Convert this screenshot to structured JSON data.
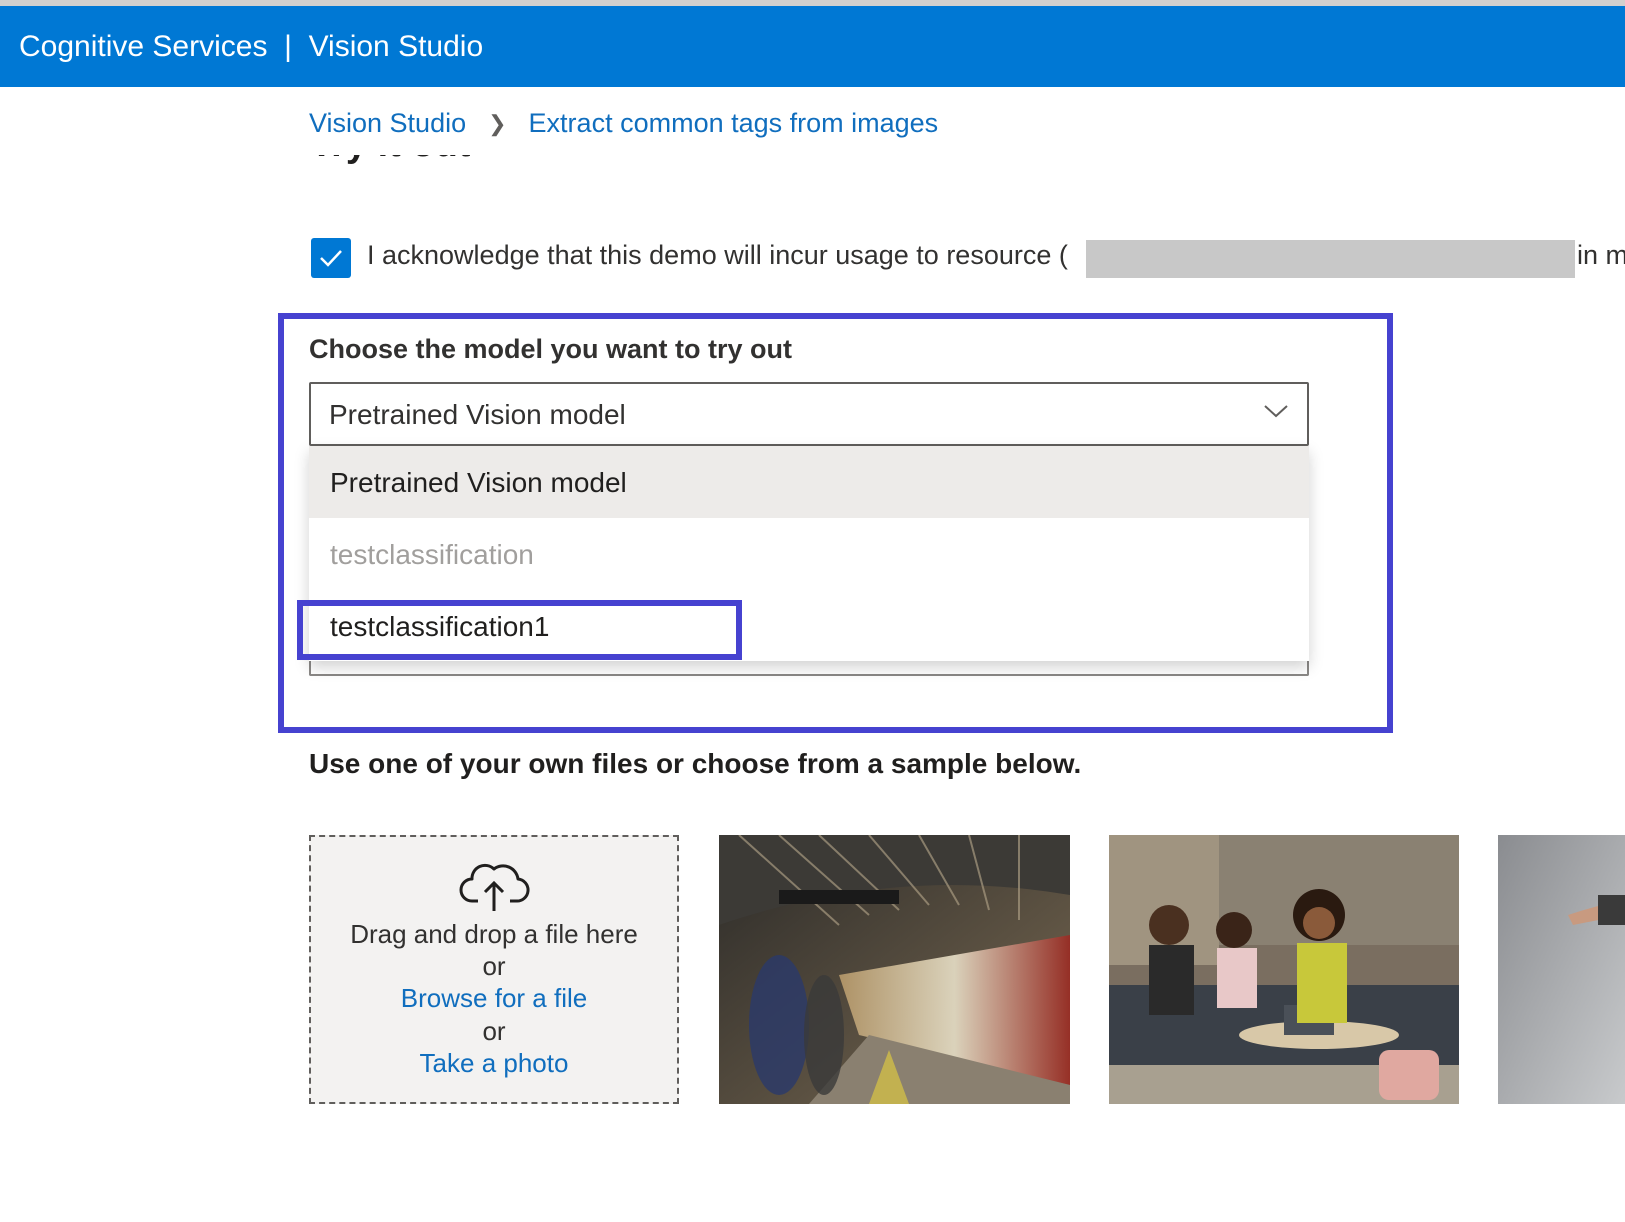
{
  "header": {
    "title": "Cognitive Services  |  Vision Studio"
  },
  "breadcrumb": {
    "home": "Vision Studio",
    "current": "Extract common tags from images"
  },
  "section": {
    "heading": "Try it out"
  },
  "acknowledge": {
    "checked": true,
    "text": "I acknowledge that this demo will incur usage to resource (",
    "tail": "in m"
  },
  "model": {
    "label": "Choose the model you want to try out",
    "selected": "Pretrained Vision model",
    "options": [
      {
        "label": "Pretrained Vision model",
        "state": "selected"
      },
      {
        "label": "testclassification",
        "state": "disabled"
      },
      {
        "label": "testclassification1",
        "state": "normal"
      }
    ]
  },
  "files": {
    "heading": "Use one of your own files or choose from a sample below.",
    "drop_text": "Drag and drop a file here",
    "or1": "or",
    "browse": "Browse for a file",
    "or2": "or",
    "photo": "Take a photo"
  },
  "samples": [
    "subway-train-platform",
    "people-meeting-on-couch",
    "person-jumping"
  ],
  "colors": {
    "brand": "#0078d4",
    "highlight": "#4642d0",
    "link": "#106ebe"
  }
}
